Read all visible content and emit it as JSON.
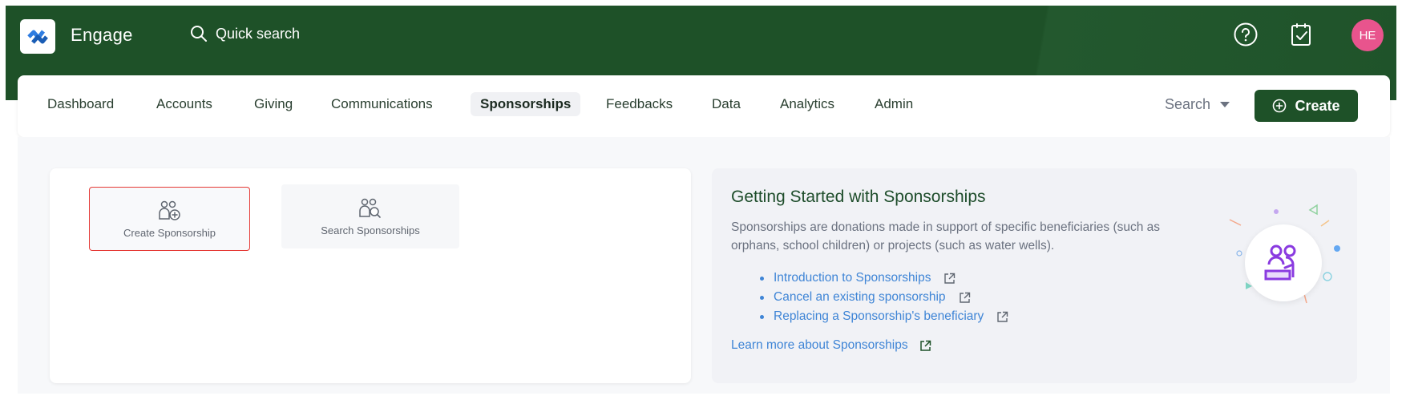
{
  "header": {
    "app_title": "Engage",
    "quick_search_label": "Quick search",
    "avatar_initials": "HE",
    "avatar_color": "#e8548d",
    "brand_color": "#1e5128"
  },
  "nav": {
    "items": [
      {
        "label": "Dashboard"
      },
      {
        "label": "Accounts"
      },
      {
        "label": "Giving"
      },
      {
        "label": "Communications"
      },
      {
        "label": "Sponsorships",
        "active": true
      },
      {
        "label": "Feedbacks"
      },
      {
        "label": "Data"
      },
      {
        "label": "Analytics"
      },
      {
        "label": "Admin"
      }
    ],
    "search_label": "Search",
    "create_label": "Create"
  },
  "tiles": [
    {
      "label": "Create Sponsorship",
      "icon": "person-add-icon",
      "selected": true
    },
    {
      "label": "Search Sponsorships",
      "icon": "person-search-icon",
      "selected": false
    }
  ],
  "info": {
    "title": "Getting Started with Sponsorships",
    "description": "Sponsorships are donations made in support of specific beneficiaries (such as orphans, school children) or projects (such as water wells).",
    "links": [
      {
        "label": "Introduction to Sponsorships"
      },
      {
        "label": "Cancel an existing sponsorship"
      },
      {
        "label": "Replacing a Sponsorship's beneficiary"
      }
    ],
    "learn_more": "Learn more about Sponsorships",
    "link_color": "#3f85d6"
  }
}
